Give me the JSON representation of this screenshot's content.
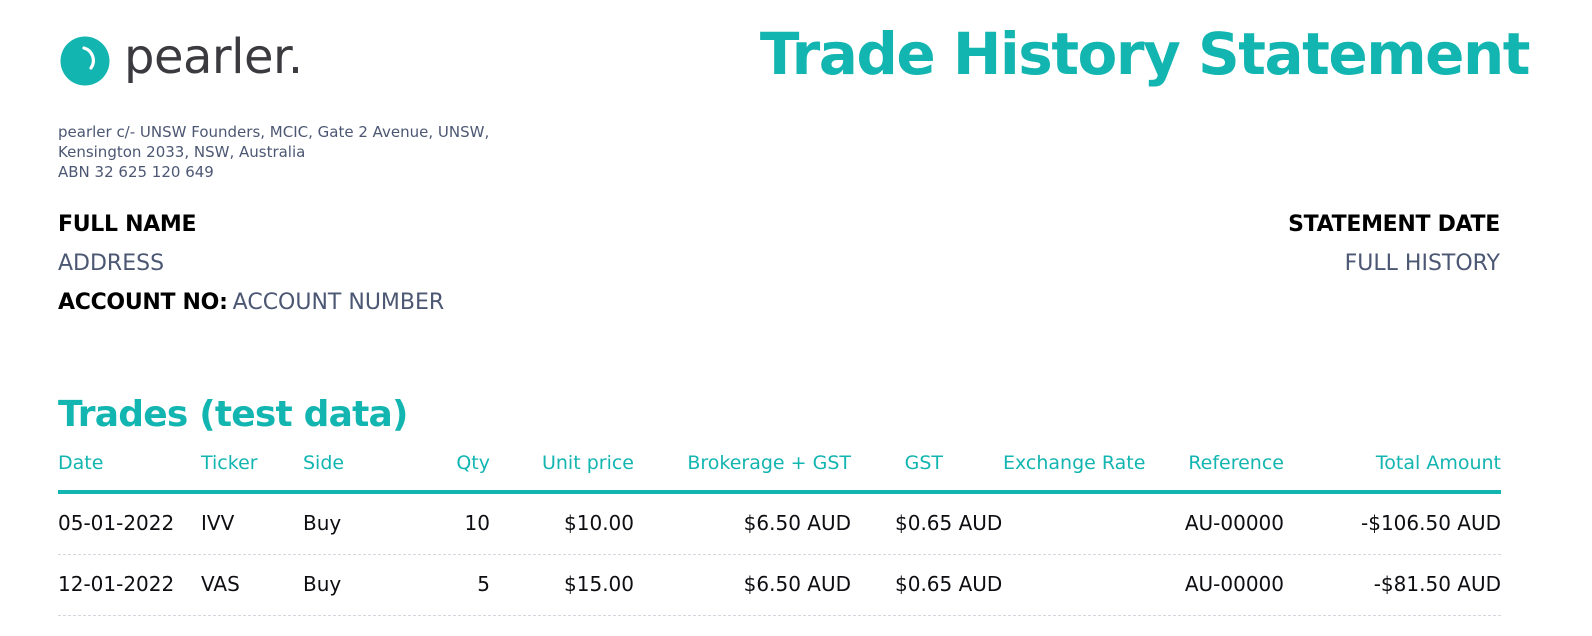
{
  "brand": {
    "name": "pearler.",
    "accent_color": "#13b5b1",
    "text_color": "#3a3a3f"
  },
  "header": {
    "title": "Trade History Statement"
  },
  "company": {
    "address_line1": "pearler c/- UNSW Founders, MCIC, Gate 2 Avenue, UNSW,",
    "address_line2": "Kensington 2033, NSW, Australia",
    "abn": "ABN 32 625 120 649"
  },
  "customer": {
    "full_name": "FULL NAME",
    "address": "ADDRESS",
    "account_label": "ACCOUNT NO:",
    "account_value": "ACCOUNT NUMBER"
  },
  "statement": {
    "date_label": "STATEMENT DATE",
    "period": "FULL HISTORY"
  },
  "trades": {
    "section_title": "Trades (test data)",
    "columns": {
      "date": "Date",
      "ticker": "Ticker",
      "side": "Side",
      "qty": "Qty",
      "unit_price": "Unit price",
      "brokerage": "Brokerage + GST",
      "gst": "GST",
      "exchange_rate": "Exchange Rate",
      "reference": "Reference",
      "total": "Total Amount"
    },
    "rows": [
      {
        "date": "05-01-2022",
        "ticker": "IVV",
        "side": "Buy",
        "qty": "10",
        "unit_price": "$10.00",
        "brokerage": "$6.50 AUD",
        "gst": "$0.65 AUD",
        "exchange_rate": "",
        "reference": "AU-00000",
        "total": "-$106.50 AUD"
      },
      {
        "date": "12-01-2022",
        "ticker": "VAS",
        "side": "Buy",
        "qty": "5",
        "unit_price": "$15.00",
        "brokerage": "$6.50 AUD",
        "gst": "$0.65 AUD",
        "exchange_rate": "",
        "reference": "AU-00000",
        "total": "-$81.50 AUD"
      }
    ]
  }
}
